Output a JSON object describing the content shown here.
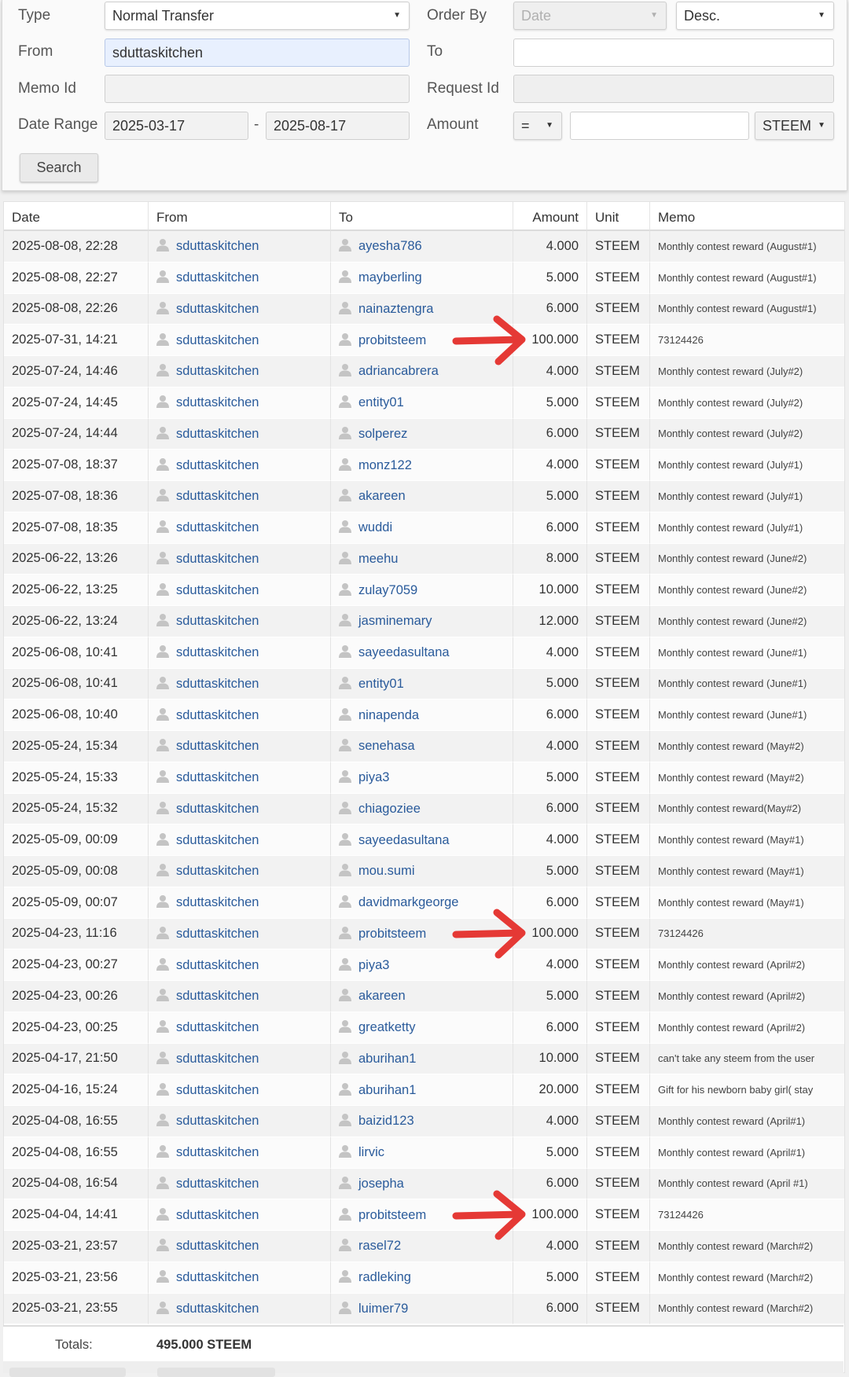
{
  "filters": {
    "type_label": "Type",
    "type_value": "Normal Transfer",
    "order_by_label": "Order By",
    "order_by_value": "Date",
    "order_dir_value": "Desc.",
    "from_label": "From",
    "from_value": "sduttaskitchen",
    "to_label": "To",
    "to_value": "",
    "memo_id_label": "Memo Id",
    "memo_id_value": "",
    "request_id_label": "Request Id",
    "request_id_value": "",
    "date_range_label": "Date Range",
    "date_from": "2025-03-17",
    "date_separator": "-",
    "date_to": "2025-08-17",
    "amount_label": "Amount",
    "amount_operator": "=",
    "amount_value": "",
    "amount_unit": "STEEM",
    "search_label": "Search"
  },
  "table": {
    "headers": {
      "date": "Date",
      "from": "From",
      "to": "To",
      "amount": "Amount",
      "unit": "Unit",
      "memo": "Memo"
    },
    "rows": [
      {
        "date": "2025-08-08, 22:28",
        "from": "sduttaskitchen",
        "to": "ayesha786",
        "amount": "4.000",
        "unit": "STEEM",
        "memo": "Monthly contest reward (August#1)"
      },
      {
        "date": "2025-08-08, 22:27",
        "from": "sduttaskitchen",
        "to": "mayberling",
        "amount": "5.000",
        "unit": "STEEM",
        "memo": "Monthly contest reward (August#1)"
      },
      {
        "date": "2025-08-08, 22:26",
        "from": "sduttaskitchen",
        "to": "nainaztengra",
        "amount": "6.000",
        "unit": "STEEM",
        "memo": "Monthly contest reward (August#1)"
      },
      {
        "date": "2025-07-31, 14:21",
        "from": "sduttaskitchen",
        "to": "probitsteem",
        "amount": "100.000",
        "unit": "STEEM",
        "memo": "73124426"
      },
      {
        "date": "2025-07-24, 14:46",
        "from": "sduttaskitchen",
        "to": "adriancabrera",
        "amount": "4.000",
        "unit": "STEEM",
        "memo": "Monthly contest reward (July#2)"
      },
      {
        "date": "2025-07-24, 14:45",
        "from": "sduttaskitchen",
        "to": "entity01",
        "amount": "5.000",
        "unit": "STEEM",
        "memo": "Monthly contest reward (July#2)"
      },
      {
        "date": "2025-07-24, 14:44",
        "from": "sduttaskitchen",
        "to": "solperez",
        "amount": "6.000",
        "unit": "STEEM",
        "memo": "Monthly contest reward (July#2)"
      },
      {
        "date": "2025-07-08, 18:37",
        "from": "sduttaskitchen",
        "to": "monz122",
        "amount": "4.000",
        "unit": "STEEM",
        "memo": "Monthly contest reward (July#1)"
      },
      {
        "date": "2025-07-08, 18:36",
        "from": "sduttaskitchen",
        "to": "akareen",
        "amount": "5.000",
        "unit": "STEEM",
        "memo": "Monthly contest reward (July#1)"
      },
      {
        "date": "2025-07-08, 18:35",
        "from": "sduttaskitchen",
        "to": "wuddi",
        "amount": "6.000",
        "unit": "STEEM",
        "memo": "Monthly contest reward (July#1)"
      },
      {
        "date": "2025-06-22, 13:26",
        "from": "sduttaskitchen",
        "to": "meehu",
        "amount": "8.000",
        "unit": "STEEM",
        "memo": "Monthly contest reward (June#2)"
      },
      {
        "date": "2025-06-22, 13:25",
        "from": "sduttaskitchen",
        "to": "zulay7059",
        "amount": "10.000",
        "unit": "STEEM",
        "memo": "Monthly contest reward (June#2)"
      },
      {
        "date": "2025-06-22, 13:24",
        "from": "sduttaskitchen",
        "to": "jasminemary",
        "amount": "12.000",
        "unit": "STEEM",
        "memo": "Monthly contest reward (June#2)"
      },
      {
        "date": "2025-06-08, 10:41",
        "from": "sduttaskitchen",
        "to": "sayeedasultana",
        "amount": "4.000",
        "unit": "STEEM",
        "memo": "Monthly contest reward (June#1)"
      },
      {
        "date": "2025-06-08, 10:41",
        "from": "sduttaskitchen",
        "to": "entity01",
        "amount": "5.000",
        "unit": "STEEM",
        "memo": "Monthly contest reward (June#1)"
      },
      {
        "date": "2025-06-08, 10:40",
        "from": "sduttaskitchen",
        "to": "ninapenda",
        "amount": "6.000",
        "unit": "STEEM",
        "memo": "Monthly contest reward (June#1)"
      },
      {
        "date": "2025-05-24, 15:34",
        "from": "sduttaskitchen",
        "to": "senehasa",
        "amount": "4.000",
        "unit": "STEEM",
        "memo": "Monthly contest reward (May#2)"
      },
      {
        "date": "2025-05-24, 15:33",
        "from": "sduttaskitchen",
        "to": "piya3",
        "amount": "5.000",
        "unit": "STEEM",
        "memo": "Monthly contest reward (May#2)"
      },
      {
        "date": "2025-05-24, 15:32",
        "from": "sduttaskitchen",
        "to": "chiagoziee",
        "amount": "6.000",
        "unit": "STEEM",
        "memo": "Monthly contest reward(May#2)"
      },
      {
        "date": "2025-05-09, 00:09",
        "from": "sduttaskitchen",
        "to": "sayeedasultana",
        "amount": "4.000",
        "unit": "STEEM",
        "memo": "Monthly contest reward (May#1)"
      },
      {
        "date": "2025-05-09, 00:08",
        "from": "sduttaskitchen",
        "to": "mou.sumi",
        "amount": "5.000",
        "unit": "STEEM",
        "memo": "Monthly contest reward (May#1)"
      },
      {
        "date": "2025-05-09, 00:07",
        "from": "sduttaskitchen",
        "to": "davidmarkgeorge",
        "amount": "6.000",
        "unit": "STEEM",
        "memo": "Monthly contest reward (May#1)"
      },
      {
        "date": "2025-04-23, 11:16",
        "from": "sduttaskitchen",
        "to": "probitsteem",
        "amount": "100.000",
        "unit": "STEEM",
        "memo": "73124426"
      },
      {
        "date": "2025-04-23, 00:27",
        "from": "sduttaskitchen",
        "to": "piya3",
        "amount": "4.000",
        "unit": "STEEM",
        "memo": "Monthly contest reward (April#2)"
      },
      {
        "date": "2025-04-23, 00:26",
        "from": "sduttaskitchen",
        "to": "akareen",
        "amount": "5.000",
        "unit": "STEEM",
        "memo": "Monthly contest reward (April#2)"
      },
      {
        "date": "2025-04-23, 00:25",
        "from": "sduttaskitchen",
        "to": "greatketty",
        "amount": "6.000",
        "unit": "STEEM",
        "memo": "Monthly contest reward (April#2)"
      },
      {
        "date": "2025-04-17, 21:50",
        "from": "sduttaskitchen",
        "to": "aburihan1",
        "amount": "10.000",
        "unit": "STEEM",
        "memo": "can't take any steem from the user"
      },
      {
        "date": "2025-04-16, 15:24",
        "from": "sduttaskitchen",
        "to": "aburihan1",
        "amount": "20.000",
        "unit": "STEEM",
        "memo": "Gift for his newborn baby girl( stay"
      },
      {
        "date": "2025-04-08, 16:55",
        "from": "sduttaskitchen",
        "to": "baizid123",
        "amount": "4.000",
        "unit": "STEEM",
        "memo": "Monthly contest reward (April#1)"
      },
      {
        "date": "2025-04-08, 16:55",
        "from": "sduttaskitchen",
        "to": "lirvic",
        "amount": "5.000",
        "unit": "STEEM",
        "memo": "Monthly contest reward (April#1)"
      },
      {
        "date": "2025-04-08, 16:54",
        "from": "sduttaskitchen",
        "to": "josepha",
        "amount": "6.000",
        "unit": "STEEM",
        "memo": "Monthly contest reward (April #1)"
      },
      {
        "date": "2025-04-04, 14:41",
        "from": "sduttaskitchen",
        "to": "probitsteem",
        "amount": "100.000",
        "unit": "STEEM",
        "memo": "73124426"
      },
      {
        "date": "2025-03-21, 23:57",
        "from": "sduttaskitchen",
        "to": "rasel72",
        "amount": "4.000",
        "unit": "STEEM",
        "memo": "Monthly contest reward (March#2)"
      },
      {
        "date": "2025-03-21, 23:56",
        "from": "sduttaskitchen",
        "to": "radleking",
        "amount": "5.000",
        "unit": "STEEM",
        "memo": "Monthly contest reward (March#2)"
      },
      {
        "date": "2025-03-21, 23:55",
        "from": "sduttaskitchen",
        "to": "luimer79",
        "amount": "6.000",
        "unit": "STEEM",
        "memo": "Monthly contest reward (March#2)"
      }
    ],
    "totals_label": "Totals:",
    "totals_value": "495.000 STEEM"
  },
  "annotations": {
    "arrow_color": "#e53935",
    "arrow_rows": [
      3,
      22,
      31
    ]
  },
  "colors": {
    "link": "#2a5b9b",
    "row_odd": "#f2f2f2",
    "row_even": "#fbfbfb",
    "user_icon": "#c4c4c4"
  },
  "icons": {
    "user": "user-icon",
    "dropdown": "caret-down-icon",
    "annotation": "red-arrow-icon"
  }
}
